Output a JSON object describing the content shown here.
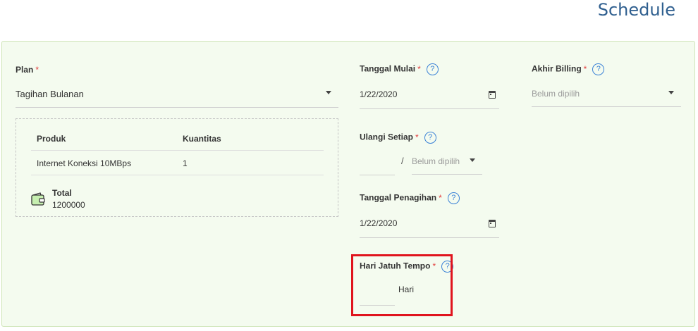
{
  "header": {
    "title": "Schedule"
  },
  "plan": {
    "label": "Plan",
    "required": "*",
    "value": "Tagihan Bulanan"
  },
  "products_table": {
    "columns": [
      "Produk",
      "Kuantitas"
    ],
    "rows": [
      {
        "product": "Internet Koneksi 10MBps",
        "qty": "1"
      }
    ],
    "total_label": "Total",
    "total_value": "1200000"
  },
  "tanggal_mulai": {
    "label": "Tanggal Mulai",
    "required": "*",
    "help": "?",
    "value": "1/22/2020"
  },
  "ulangi_setiap": {
    "label": "Ulangi Setiap",
    "required": "*",
    "help": "?",
    "separator": "/",
    "unit_placeholder": "Belum dipilih"
  },
  "tanggal_penagihan": {
    "label": "Tanggal Penagihan",
    "required": "*",
    "help": "?",
    "value": "1/22/2020"
  },
  "hari_jatuh_tempo": {
    "label": "Hari Jatuh Tempo",
    "required": "*",
    "help": "?",
    "suffix": "Hari"
  },
  "akhir_billing": {
    "label": "Akhir Billing",
    "required": "*",
    "help": "?",
    "placeholder": "Belum dipilih"
  },
  "colors": {
    "title": "#2f5f8f",
    "panel_bg": "#f4fbef",
    "panel_border": "#cfe5b8",
    "required": "#e23c3c",
    "help": "#3b82d6",
    "highlight": "#e0141e"
  }
}
